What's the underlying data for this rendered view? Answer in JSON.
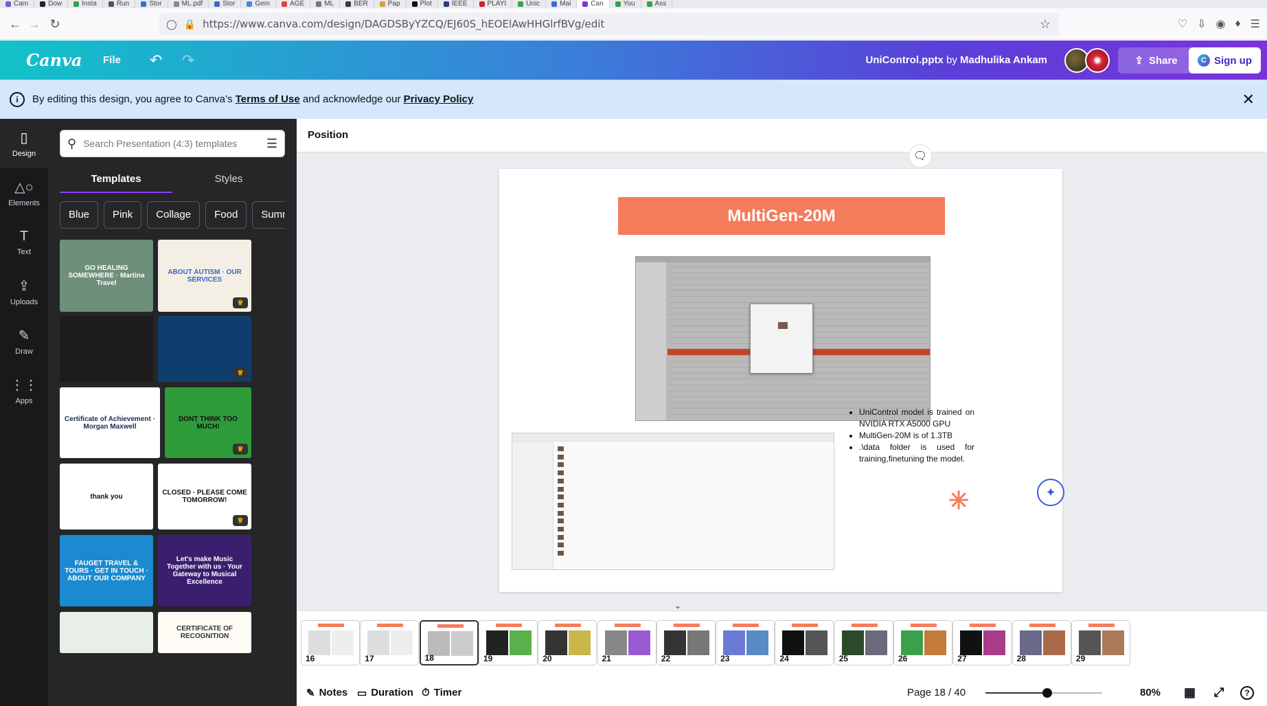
{
  "browser": {
    "tabs": [
      "Cam",
      "Dow",
      "Insta",
      "Run",
      "Stor",
      "ML.pdf",
      "Stor",
      "Gem",
      "AGE",
      "ML",
      "BER",
      "Pap",
      "Plot",
      "IEEE",
      "PLAYI",
      "Unic",
      "Mai",
      "Can",
      "You",
      "Ass"
    ],
    "url": "https://www.canva.com/design/DAGDSByYZCQ/EJ60S_hEOElAwHHGlrfBVg/edit"
  },
  "header": {
    "logo": "Canva",
    "file_label": "File",
    "doc_name": "UniControl.pptx",
    "by_label": " by ",
    "author": "Madhulika Ankam",
    "share_label": "Share",
    "signup_label": "Sign up"
  },
  "terms": {
    "prefix": "By editing this design, you agree to Canva’s ",
    "terms_link": "Terms of Use",
    "middle": " and acknowledge our ",
    "privacy_link": "Privacy Policy"
  },
  "rail": [
    {
      "label": "Design",
      "icon": "design-icon"
    },
    {
      "label": "Elements",
      "icon": "elements-icon"
    },
    {
      "label": "Text",
      "icon": "text-icon"
    },
    {
      "label": "Uploads",
      "icon": "uploads-icon"
    },
    {
      "label": "Draw",
      "icon": "draw-icon"
    },
    {
      "label": "Apps",
      "icon": "apps-icon"
    }
  ],
  "panel": {
    "search_placeholder": "Search Presentation (4:3) templates",
    "tabs": [
      "Templates",
      "Styles"
    ],
    "chips": [
      "Blue",
      "Pink",
      "Collage",
      "Food",
      "Summ"
    ],
    "templates": [
      {
        "text": "GO HEALING SOMEWHERE · Martina Travel",
        "bg": "#6e8f7a",
        "color": "#fff"
      },
      {
        "text": "ABOUT AUTISM · OUR SERVICES",
        "bg": "#f4efe4",
        "color": "#3a66c4"
      },
      {
        "text": "",
        "bg": "#1c1c1c",
        "color": "#d4af37"
      },
      {
        "text": "",
        "bg": "#0f3d6e",
        "color": "#fff"
      },
      {
        "text": "Certificate of Achievement · Morgan Maxwell",
        "bg": "#ffffff",
        "color": "#1d2b5a"
      },
      {
        "text": "DONT THINK TOO MUCH!",
        "bg": "#2e9b3a",
        "color": "#111"
      },
      {
        "text": "thank you",
        "bg": "#ffffff",
        "color": "#111"
      },
      {
        "text": "CLOSED · PLEASE COME TOMORROW!",
        "bg": "#ffffff",
        "color": "#111"
      },
      {
        "text": "FAUGET TRAVEL & TOURS · GET IN TOUCH · ABOUT OUR COMPANY",
        "bg": "#1b8ad0",
        "color": "#fff"
      },
      {
        "text": "Let's make Music Together with us · Your Gateway to Musical Excellence",
        "bg": "#3a1f6e",
        "color": "#fff"
      },
      {
        "text": "",
        "bg": "#e7efe6",
        "color": "#555"
      },
      {
        "text": "CERTIFICATE OF RECOGNITION",
        "bg": "#fdfbf4",
        "color": "#333"
      }
    ]
  },
  "workspace": {
    "position_label": "Position",
    "slide": {
      "title": "MultiGen-20M",
      "bullets": [
        "UniControl model is trained on NVIDIA RTX A5000 GPU",
        "MultiGen-20M is of 1.3TB",
        ".\\data folder is used for training,finetuning the model."
      ]
    }
  },
  "filmstrip": [
    {
      "num": "16",
      "palette": [
        "#ddd",
        "#eee"
      ]
    },
    {
      "num": "17",
      "palette": [
        "#ddd",
        "#eee"
      ]
    },
    {
      "num": "18",
      "palette": [
        "#bbb",
        "#ccc"
      ],
      "active": true
    },
    {
      "num": "19",
      "palette": [
        "#222",
        "#5ab04a"
      ]
    },
    {
      "num": "20",
      "palette": [
        "#333",
        "#c9b54a"
      ]
    },
    {
      "num": "21",
      "palette": [
        "#888",
        "#9a5ad4"
      ]
    },
    {
      "num": "22",
      "palette": [
        "#333",
        "#777"
      ]
    },
    {
      "num": "23",
      "palette": [
        "#6a7ad4",
        "#5a8ac4"
      ]
    },
    {
      "num": "24",
      "palette": [
        "#111",
        "#555"
      ]
    },
    {
      "num": "25",
      "palette": [
        "#2a4a2a",
        "#6a6a7a"
      ]
    },
    {
      "num": "26",
      "palette": [
        "#3aa04a",
        "#c47a3a"
      ]
    },
    {
      "num": "27",
      "palette": [
        "#111",
        "#aa3a8a"
      ]
    },
    {
      "num": "28",
      "palette": [
        "#6a6a8a",
        "#aa6a4a"
      ]
    },
    {
      "num": "29",
      "palette": [
        "#555",
        "#aa7a5a"
      ]
    }
  ],
  "bottombar": {
    "notes": "Notes",
    "duration": "Duration",
    "timer": "Timer",
    "page": "Page 18 / 40",
    "zoom": "80%",
    "zoom_fraction": 0.53
  }
}
